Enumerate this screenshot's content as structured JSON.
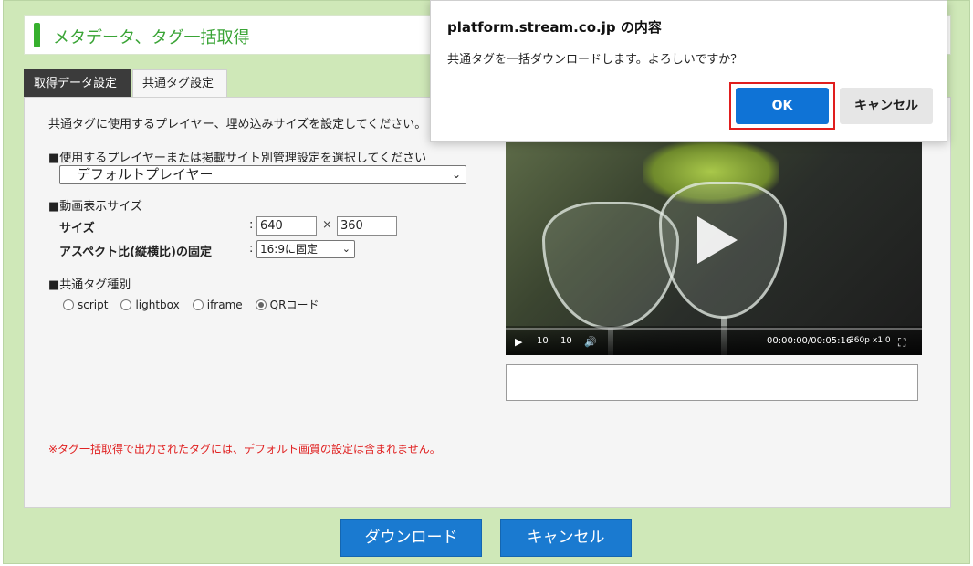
{
  "header": {
    "title": "メタデータ、タグ一括取得"
  },
  "tabs": [
    {
      "label": "取得データ設定",
      "active": false
    },
    {
      "label": "共通タグ設定",
      "active": true
    }
  ],
  "form": {
    "intro": "共通タグに使用するプレイヤー、埋め込みサイズを設定してください。",
    "player_heading": "■使用するプレイヤーまたは掲載サイト別管理設定を選択してください",
    "player_select": "デフォルトプレイヤー",
    "size_heading": "■動画表示サイズ",
    "size_label": "サイズ",
    "colon": ":",
    "width_value": "640",
    "times": "×",
    "height_value": "360",
    "aspect_label": "アスペクト比(縦横比)の固定",
    "aspect_select": "16:9に固定",
    "tag_type_heading": "■共通タグ種別",
    "tag_types": [
      {
        "label": "script",
        "checked": false
      },
      {
        "label": "lightbox",
        "checked": false
      },
      {
        "label": "iframe",
        "checked": false
      },
      {
        "label": "QRコード",
        "checked": true
      }
    ],
    "note": "※タグ一括取得で出力されたタグには、デフォルト画質の設定は含まれません。"
  },
  "video": {
    "play_icon": "▶",
    "rewind_label": "10",
    "forward_label": "10",
    "volume_icon": "🔊",
    "time": "00:00:00/00:05:16",
    "quality": "360p",
    "speed": "x1.0",
    "fullscreen_icon": "⛶"
  },
  "buttons": {
    "download": "ダウンロード",
    "cancel": "キャンセル"
  },
  "dialog": {
    "title": "platform.stream.co.jp の内容",
    "message": "共通タグを一括ダウンロードします。よろしいですか？",
    "ok": "OK",
    "cancel": "キャンセル"
  },
  "colors": {
    "frame_bg": "#cfe8b8",
    "accent_green": "#36b02d",
    "primary_blue": "#1a7ad0",
    "dialog_ok": "#0f73d6",
    "highlight_red": "#e01e1e",
    "note_red": "#e02020"
  }
}
